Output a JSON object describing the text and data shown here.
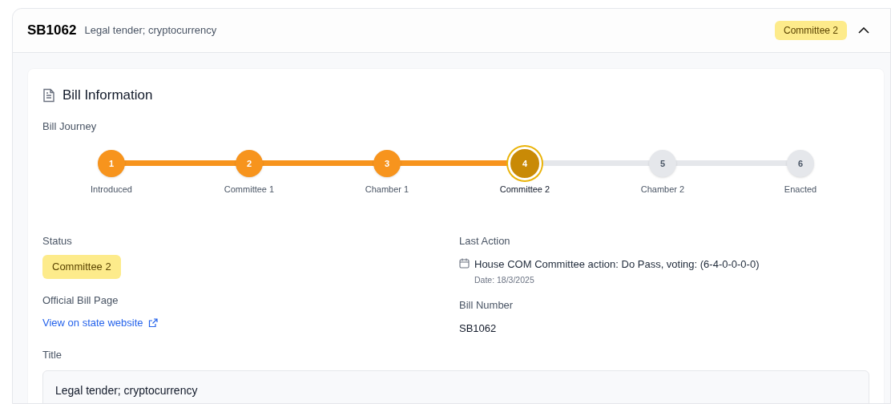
{
  "header": {
    "bill_id": "SB1062",
    "subtitle": "Legal tender; cryptocurrency",
    "status_badge": "Committee 2",
    "expanded": true
  },
  "section_title": "Bill Information",
  "journey": {
    "label": "Bill Journey",
    "steps": [
      {
        "number": "1",
        "label": "Introduced",
        "completed": true,
        "current": false
      },
      {
        "number": "2",
        "label": "Committee 1",
        "completed": true,
        "current": false
      },
      {
        "number": "3",
        "label": "Chamber 1",
        "completed": true,
        "current": false
      },
      {
        "number": "4",
        "label": "Committee 2",
        "completed": true,
        "current": true
      },
      {
        "number": "5",
        "label": "Chamber 2",
        "completed": false,
        "current": false
      },
      {
        "number": "6",
        "label": "Enacted",
        "completed": false,
        "current": false
      }
    ]
  },
  "status": {
    "label": "Status",
    "value": "Committee 2"
  },
  "last_action": {
    "label": "Last Action",
    "text": "House COM Committee action: Do Pass, voting: (6-4-0-0-0-0)",
    "date": "Date: 18/3/2025"
  },
  "official_page": {
    "label": "Official Bill Page",
    "link": "View on state website"
  },
  "bill_number": {
    "label": "Bill Number",
    "value": "SB1062"
  },
  "title": {
    "label": "Title",
    "value": "Legal tender; cryptocurrency"
  }
}
